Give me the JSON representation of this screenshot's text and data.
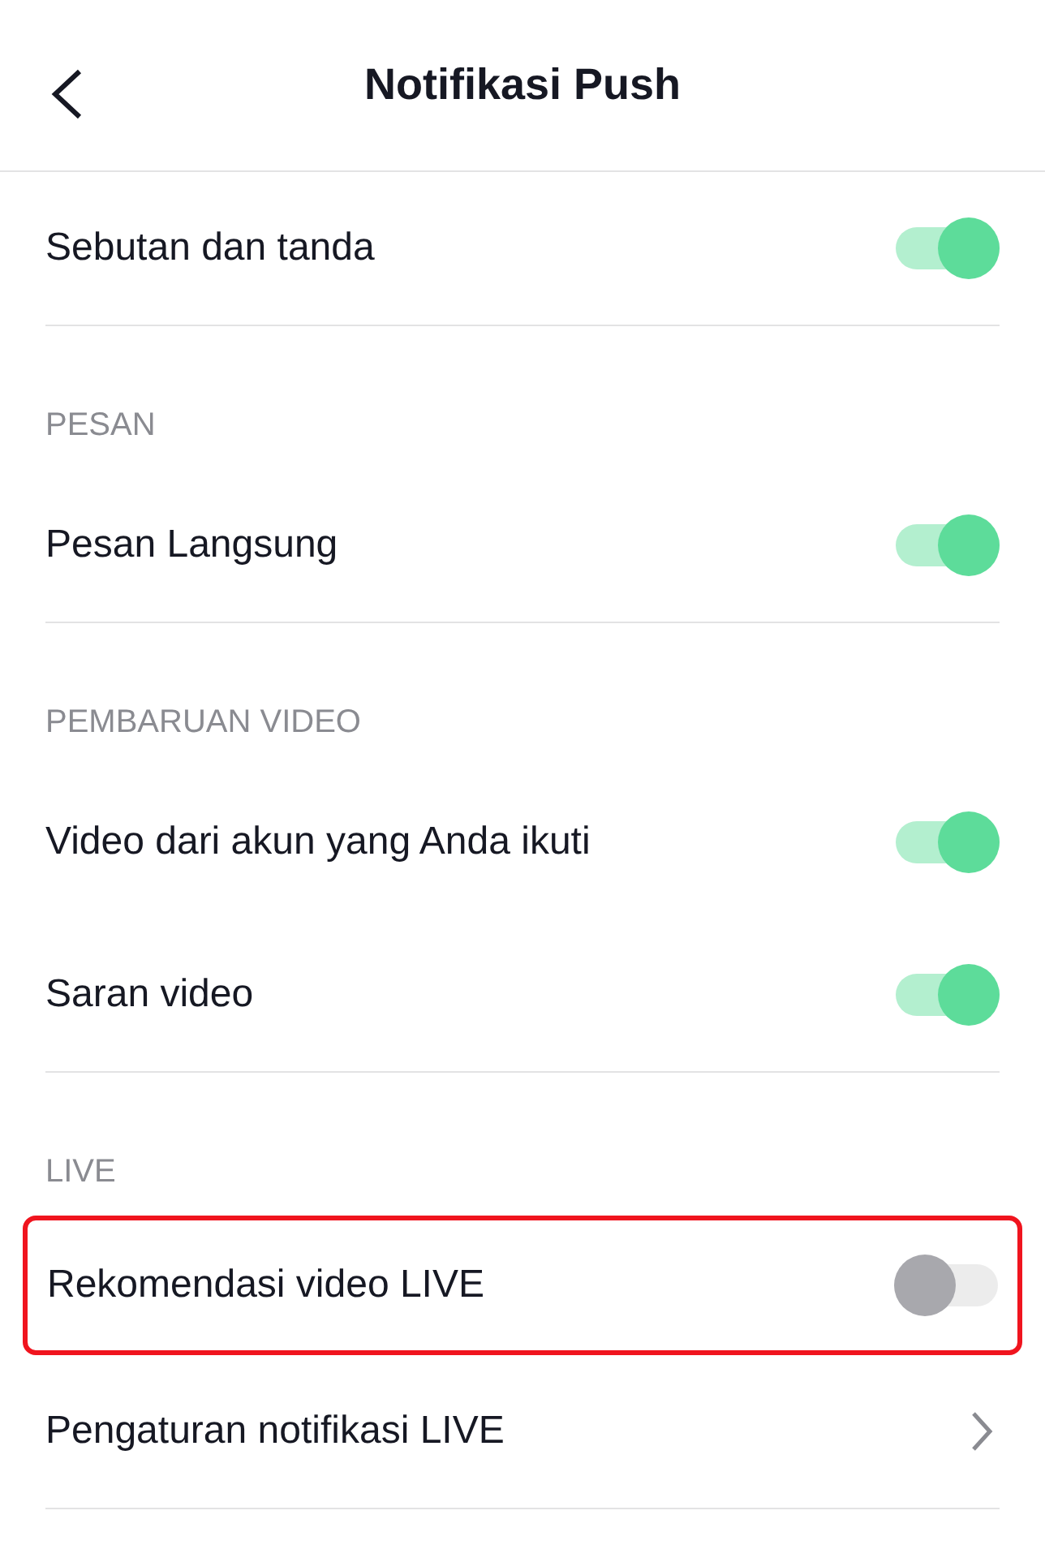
{
  "header": {
    "title": "Notifikasi Push"
  },
  "sections": [
    {
      "items": [
        {
          "label": "Sebutan dan tanda",
          "kind": "toggle",
          "on": true,
          "highlighted": false
        }
      ]
    },
    {
      "heading": "PESAN",
      "items": [
        {
          "label": "Pesan Langsung",
          "kind": "toggle",
          "on": true,
          "highlighted": false
        }
      ]
    },
    {
      "heading": "PEMBARUAN VIDEO",
      "items": [
        {
          "label": "Video dari akun yang Anda ikuti",
          "kind": "toggle",
          "on": true,
          "highlighted": false
        },
        {
          "label": "Saran video",
          "kind": "toggle",
          "on": true,
          "highlighted": false
        }
      ]
    },
    {
      "heading": "LIVE",
      "items": [
        {
          "label": "Rekomendasi video LIVE",
          "kind": "toggle",
          "on": false,
          "highlighted": true
        },
        {
          "label": "Pengaturan notifikasi LIVE",
          "kind": "link",
          "highlighted": false
        }
      ]
    }
  ]
}
